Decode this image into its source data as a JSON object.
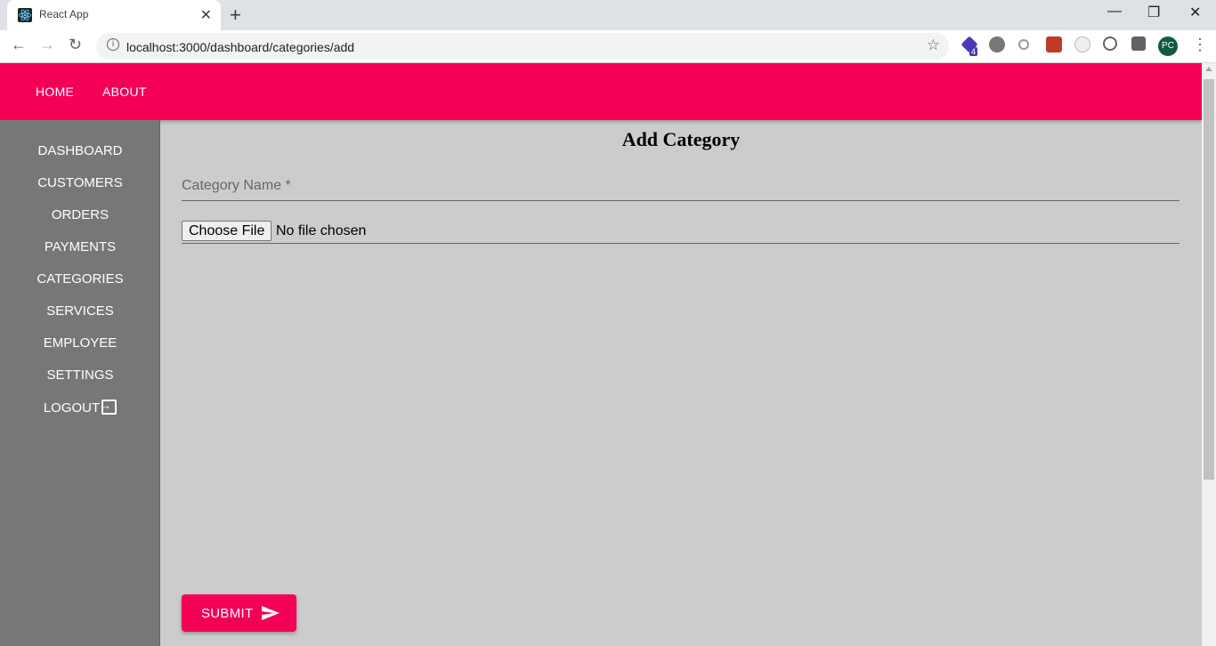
{
  "browser": {
    "tab_title": "React App",
    "tab_close": "✕",
    "new_tab": "+",
    "url": "localhost:3000/dashboard/categories/add",
    "extension_badge": "4",
    "profile_initials": "PC",
    "window_controls": {
      "minimize": "—",
      "restore": "❐",
      "close": "✕"
    },
    "nav": {
      "back": "←",
      "forward": "→",
      "reload": "↻"
    },
    "star": "☆",
    "menu": "⋮",
    "info": "i"
  },
  "appbar": {
    "color": "#f50057",
    "links": [
      "HOME",
      "ABOUT"
    ]
  },
  "sidebar": {
    "items": [
      "DASHBOARD",
      "CUSTOMERS",
      "ORDERS",
      "PAYMENTS",
      "CATEGORIES",
      "SERVICES",
      "EMPLOYEE",
      "SETTINGS",
      "LOGOUT"
    ]
  },
  "main": {
    "title": "Add Category",
    "category_field_label": "Category Name *",
    "file_button": "Choose File",
    "file_status": "No file chosen",
    "submit_label": "SUBMIT"
  }
}
